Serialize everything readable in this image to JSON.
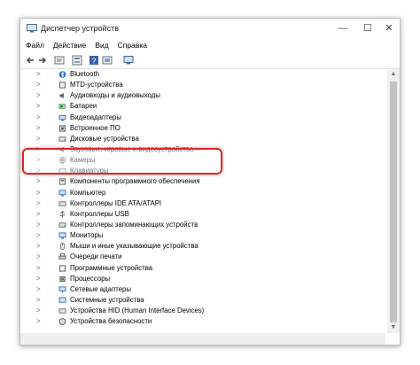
{
  "window": {
    "title": "Диспетчер устройств",
    "controls": {
      "minimize": "—",
      "maximize": "☐",
      "close": "✕"
    }
  },
  "menu": [
    {
      "label": "Файл"
    },
    {
      "label": "Действие"
    },
    {
      "label": "Вид"
    },
    {
      "label": "Справка"
    }
  ],
  "toolbar": {
    "icons": [
      "back-arrow-icon",
      "forward-arrow-icon",
      "properties-icon",
      "show-hide-icon",
      "help-icon",
      "update-driver-icon",
      "monitor-icon"
    ]
  },
  "tree": [
    {
      "label": "Bluetooth",
      "icon": "bluetooth-icon",
      "color": "#1a6fd6"
    },
    {
      "label": "MTD-устройства",
      "icon": "device-icon",
      "color": "#555555"
    },
    {
      "label": "Аудиовходы и аудиовыходы",
      "icon": "speaker-icon",
      "color": "#5b5b5b"
    },
    {
      "label": "Батареи",
      "icon": "battery-icon",
      "color": "#3a8a3a"
    },
    {
      "label": "Видеоадаптеры",
      "icon": "display-adapter-icon",
      "color": "#2b6cb0"
    },
    {
      "label": "Встроенное ПО",
      "icon": "firmware-icon",
      "color": "#555555"
    },
    {
      "label": "Дисковые устройства",
      "icon": "disk-icon",
      "color": "#666666"
    },
    {
      "label": "Звуковые, игровые и видеоустройства",
      "icon": "sound-icon",
      "color": "#5b5b5b"
    },
    {
      "label": "Камеры",
      "icon": "camera-icon",
      "color": "#444444"
    },
    {
      "label": "Клавиатуры",
      "icon": "keyboard-icon",
      "color": "#666666"
    },
    {
      "label": "Компоненты программного обеспечения",
      "icon": "software-icon",
      "color": "#555555"
    },
    {
      "label": "Компьютер",
      "icon": "computer-icon",
      "color": "#2b6cb0"
    },
    {
      "label": "Контроллеры IDE ATA/ATAPI",
      "icon": "ide-icon",
      "color": "#666666"
    },
    {
      "label": "Контроллеры USB",
      "icon": "usb-icon",
      "color": "#555555"
    },
    {
      "label": "Контроллеры запоминающих устройств",
      "icon": "storage-icon",
      "color": "#666666"
    },
    {
      "label": "Мониторы",
      "icon": "monitor-icon",
      "color": "#2b6cb0"
    },
    {
      "label": "Мыши и иные указывающие устройства",
      "icon": "mouse-icon",
      "color": "#666666"
    },
    {
      "label": "Очереди печати",
      "icon": "printer-icon",
      "color": "#555555"
    },
    {
      "label": "Программные устройства",
      "icon": "software-device-icon",
      "color": "#555555"
    },
    {
      "label": "Процессоры",
      "icon": "processor-icon",
      "color": "#666666"
    },
    {
      "label": "Сетевые адаптеры",
      "icon": "network-icon",
      "color": "#2b6cb0"
    },
    {
      "label": "Системные устройства",
      "icon": "system-icon",
      "color": "#2b6cb0"
    },
    {
      "label": "Устройства HID (Human Interface Devices)",
      "icon": "hid-icon",
      "color": "#666666"
    },
    {
      "label": "Устройства безопасности",
      "icon": "security-icon",
      "color": "#555555"
    }
  ],
  "highlight_color": "#d62b2b"
}
